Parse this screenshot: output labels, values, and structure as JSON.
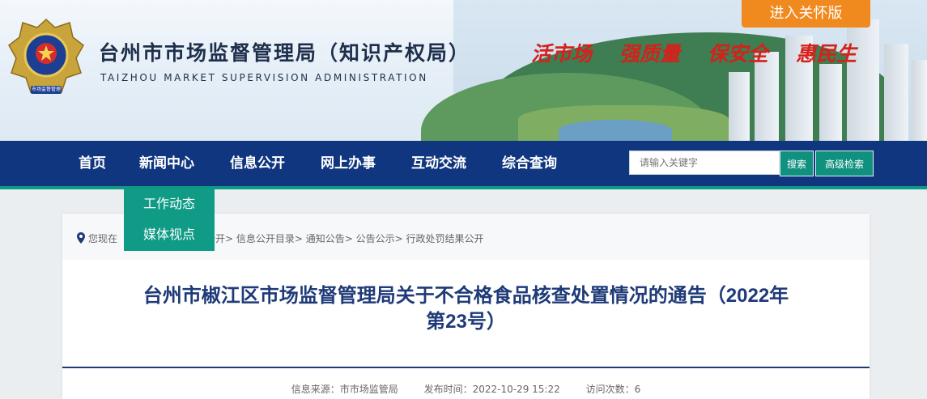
{
  "header": {
    "title": "台州市市场监督管理局（知识产权局）",
    "subtitle": "TAIZHOU MARKET SUPERVISION ADMINISTRATION",
    "emblem_text": "市场监督管理",
    "slogans": [
      "活市场",
      "强质量",
      "保安全",
      "惠民生"
    ],
    "care_button": "进入关怀版"
  },
  "nav": {
    "items": [
      "首页",
      "新闻中心",
      "信息公开",
      "网上办事",
      "互动交流",
      "综合查询"
    ],
    "search_placeholder": "请输入关键字",
    "search_button": "搜索",
    "advanced_button": "高级检索",
    "dropdown": [
      "工作动态",
      "媒体视点"
    ]
  },
  "breadcrumb": {
    "prefix": "您现在",
    "trail": "息公开> 信息公开目录> 通知公告> 公告公示> 行政处罚结果公开"
  },
  "article": {
    "title_line1": "台州市椒江区市场监督管理局关于不合格食品核查处置情况的通告（2022年",
    "title_line2": "第23号）",
    "source": "信息来源：市市场监管局",
    "published": "发布时间：2022-10-29 15:22",
    "views": "访问次数：6"
  },
  "colors": {
    "nav_bg": "#10367f",
    "accent_teal": "#109a86",
    "care_orange": "#f08a1e",
    "slogan_red": "#d6201a",
    "title_navy": "#1e3a78"
  }
}
